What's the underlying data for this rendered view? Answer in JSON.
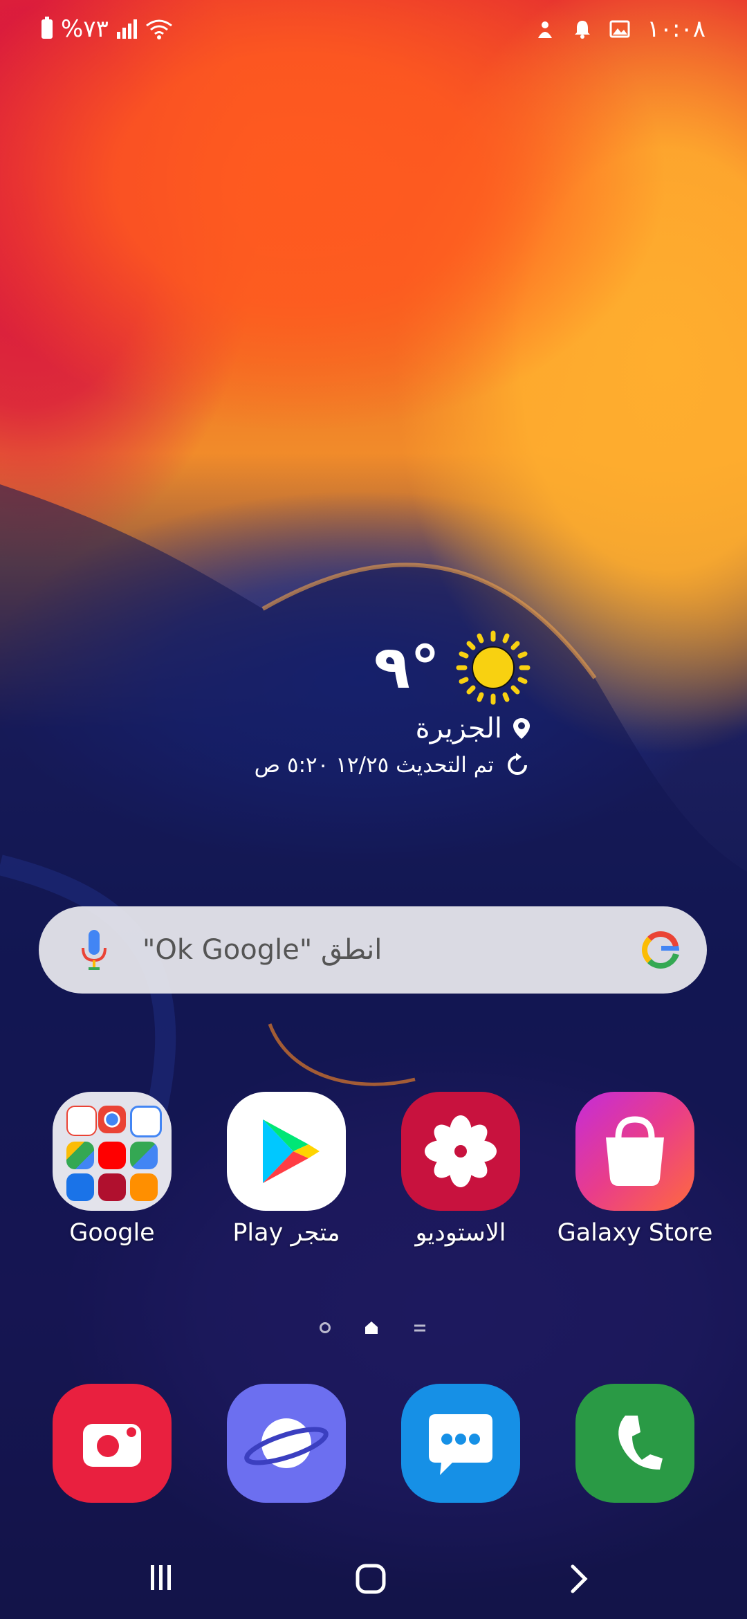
{
  "status_bar": {
    "battery_percent": "%٧٣",
    "time": "١٠:٠٨"
  },
  "weather": {
    "temperature": "٩°",
    "location": "الجزيرة",
    "updated": "تم التحديث ١٢/٢٥ ٥:٢٠ ص"
  },
  "search": {
    "placeholder": "انطق \"Ok Google\""
  },
  "apps": [
    {
      "label": "Google"
    },
    {
      "label": "Play متجر"
    },
    {
      "label": "الاستوديو"
    },
    {
      "label": "Galaxy Store"
    }
  ],
  "dock": [
    {
      "icon": "camera-icon"
    },
    {
      "icon": "internet-browser-icon"
    },
    {
      "icon": "messages-icon"
    },
    {
      "icon": "phone-icon"
    }
  ],
  "colors": {
    "gallery": "#c8123e",
    "galaxy_store": "#e93d8a",
    "camera": "#e9203f",
    "internet": "#6c6ff0",
    "messages": "#1690e6",
    "phone": "#2a9a45"
  }
}
